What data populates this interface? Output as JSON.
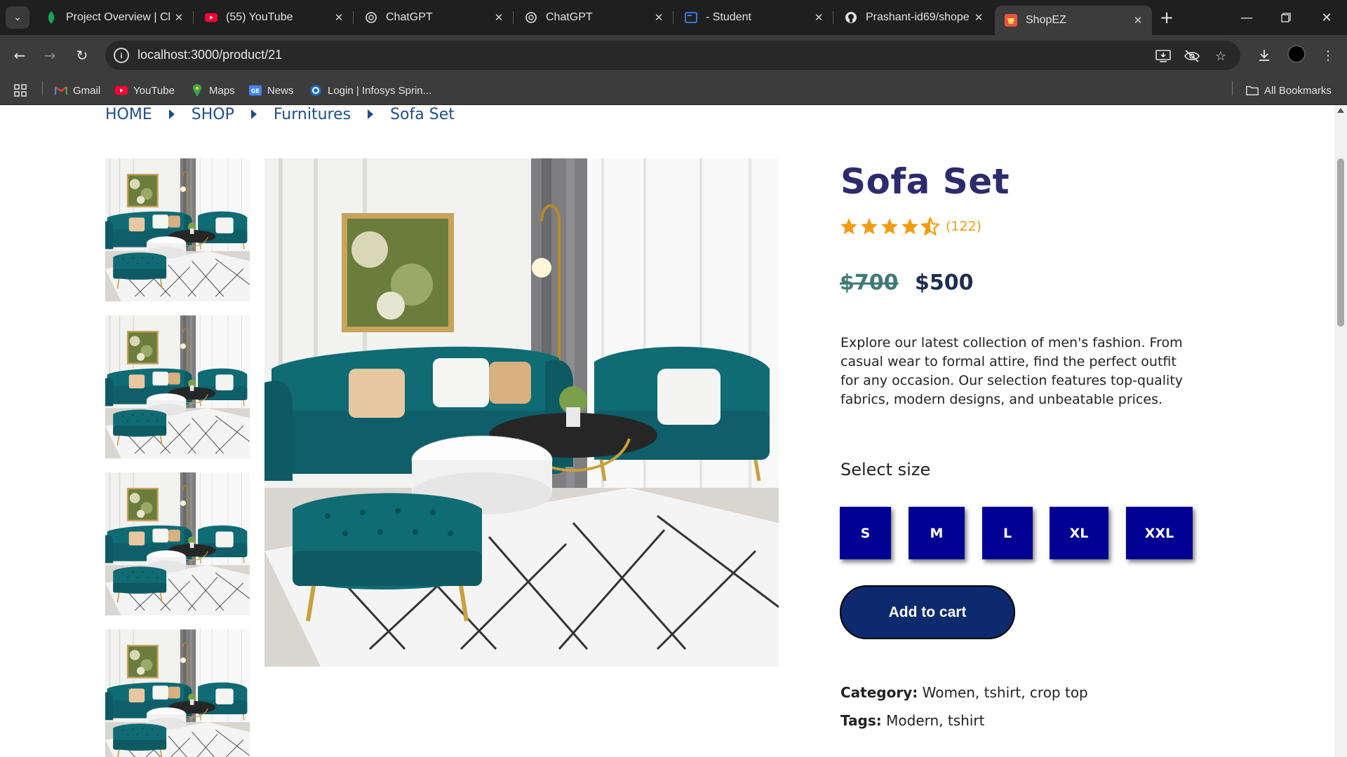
{
  "browser": {
    "tabs": [
      {
        "title": "Project Overview | Cl",
        "icon": "leaf-icon",
        "active": false
      },
      {
        "title": "(55) YouTube",
        "icon": "youtube-icon",
        "active": false
      },
      {
        "title": "ChatGPT",
        "icon": "chatgpt-icon",
        "active": false
      },
      {
        "title": "ChatGPT",
        "icon": "chatgpt-icon",
        "active": false
      },
      {
        "title": "- Student",
        "icon": "student-portal-icon",
        "active": false
      },
      {
        "title": "Prashant-id69/shope",
        "icon": "github-icon",
        "active": false
      },
      {
        "title": "ShopEZ",
        "icon": "shopez-icon",
        "active": true
      }
    ],
    "url": "localhost:3000/product/21",
    "bookmarks": [
      {
        "label": "Gmail",
        "icon": "gmail-icon"
      },
      {
        "label": "YouTube",
        "icon": "youtube-icon"
      },
      {
        "label": "Maps",
        "icon": "maps-icon"
      },
      {
        "label": "News",
        "icon": "news-icon"
      },
      {
        "label": "Login | Infosys Sprin...",
        "icon": "infosys-icon"
      }
    ],
    "all_bookmarks": "All Bookmarks"
  },
  "breadcrumb": [
    "HOME",
    "SHOP",
    "Furnitures",
    "Sofa Set"
  ],
  "product": {
    "title": "Sofa Set",
    "rating": 4.5,
    "reviews": "(122)",
    "old_price": "$700",
    "price": "$500",
    "description": "Explore our latest collection of men's fashion. From casual wear to formal attire, find the perfect outfit for any occasion. Our selection features top-quality fabrics, modern designs, and unbeatable prices.",
    "size_title": "Select size",
    "sizes": [
      "S",
      "M",
      "L",
      "XL",
      "XXL"
    ],
    "add_to_cart": "Add to cart",
    "category_label": "Category:",
    "category_value": " Women, tshirt, crop top",
    "tags_label": "Tags:",
    "tags_value": " Modern, tshirt"
  },
  "colors": {
    "title": "#2e2a6e",
    "breadcrumb": "#1f4e8c",
    "size_button": "#000092",
    "cart_button": "#0c2a6d",
    "star": "#f39c12",
    "old_price": "#3f7a78"
  }
}
